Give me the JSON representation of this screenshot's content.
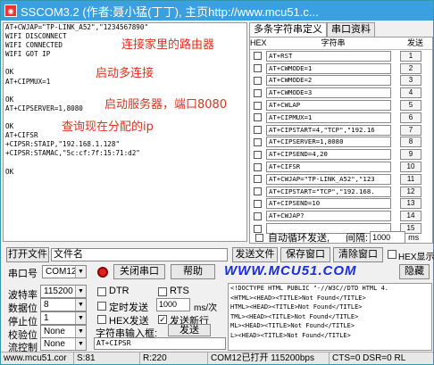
{
  "window": {
    "title": "SSCOM3.2 (作者:聂小猛(丁丁), 主页http://www.mcu51.c..."
  },
  "receive": {
    "lines": [
      "AT+CWJAP=\"TP-LINK_A52\",\"1234567890\"",
      "WIFI DISCONNECT",
      "WIFI CONNECTED",
      "WIFI GOT IP",
      "",
      "OK",
      "AT+CIPMUX=1",
      "",
      "OK",
      "AT+CIPSERVER=1,8080",
      "",
      "OK",
      "AT+CIFSR",
      "+CIPSR:STAIP,\"192.168.1.128\"",
      "+CIPSR:STAMAC,\"5c:cf:7f:15:71:d2\"",
      "",
      "OK"
    ],
    "notes": [
      "连接家里的路由器",
      "启动多连接",
      "启动服务器，端口8080",
      "查询现在分配的ip"
    ]
  },
  "multi": {
    "tabs": [
      "多条字符串定义",
      "串口资料"
    ],
    "head": {
      "hex": "HEX",
      "string": "字符串",
      "send": "发送"
    },
    "rows": [
      {
        "cmd": "AT+RST",
        "btn": "1"
      },
      {
        "cmd": "AT+CWMODE=1",
        "btn": "2"
      },
      {
        "cmd": "AT+CWMODE=2",
        "btn": "3"
      },
      {
        "cmd": "AT+CWMODE=3",
        "btn": "4"
      },
      {
        "cmd": "AT+CWLAP",
        "btn": "5"
      },
      {
        "cmd": "AT+CIPMUX=1",
        "btn": "6"
      },
      {
        "cmd": "AT+CIPSTART=4,\"TCP\",\"192.16",
        "btn": "7"
      },
      {
        "cmd": "AT+CIPSERVER=1,8080",
        "btn": "8"
      },
      {
        "cmd": "AT+CIPSEND=4,20",
        "btn": "9"
      },
      {
        "cmd": "AT+CIFSR",
        "btn": "10"
      },
      {
        "cmd": "AT+CWJAP=\"TP-LINK_A52\",\"123",
        "btn": "11"
      },
      {
        "cmd": "AT+CIPSTART=\"TCP\",\"192.168.",
        "btn": "12"
      },
      {
        "cmd": "AT+CIPSEND=10",
        "btn": "13"
      },
      {
        "cmd": "AT+CWJAP?",
        "btn": "14"
      },
      {
        "cmd": "",
        "btn": "15"
      }
    ],
    "loop_label": "自动循环发送,",
    "interval_label": "间隔:",
    "interval_value": "1000",
    "interval_unit": "ms"
  },
  "toolbar1": {
    "open_file": "打开文件",
    "filename": "文件名",
    "send_file": "发送文件",
    "save_window": "保存窗口",
    "clear_window": "清除窗口",
    "hex_display": "HEX显示"
  },
  "toolbar2": {
    "port_label": "串口号",
    "port_value": "COM12",
    "close_port": "关闭串口",
    "help": "帮助",
    "brand": "WWW.MCU51.COM",
    "hide": "隐藏"
  },
  "settings": {
    "baud_label": "波特率",
    "baud_value": "115200",
    "data_label": "数据位",
    "data_value": "8",
    "stop_label": "停止位",
    "stop_value": "1",
    "parity_label": "校验位",
    "parity_value": "None",
    "flow_label": "流控制",
    "flow_value": "None",
    "dtr": "DTR",
    "rts": "RTS",
    "timed_send": "定时发送",
    "timed_value": "1000",
    "timed_unit": "ms/次",
    "hex_send": "HEX发送",
    "send_newline": "发送新行",
    "input_label": "字符串输入框:",
    "send_btn": "发送",
    "input_value": "AT+CIPSR"
  },
  "output": {
    "lines": [
      "<!DOCTYPE HTML PUBLIC \"-//W3C//DTD HTML 4.",
      "<HTML><HEAD><TITLE>Not Found</TITLE>",
      "HTML><HEAD><TITLE>Not Found</TITLE>",
      "TML><HEAD><TITLE>Not Found</TITLE>",
      "ML><HEAD><TITLE>Not Found</TITLE>",
      "L><HEAD><TITLE>Not Found</TITLE>"
    ]
  },
  "status": {
    "url": "www.mcu51.cor",
    "s": "S:81",
    "r": "R:220",
    "port_state": "COM12已打开  115200bps",
    "signals": "CTS=0 DSR=0 RL"
  }
}
